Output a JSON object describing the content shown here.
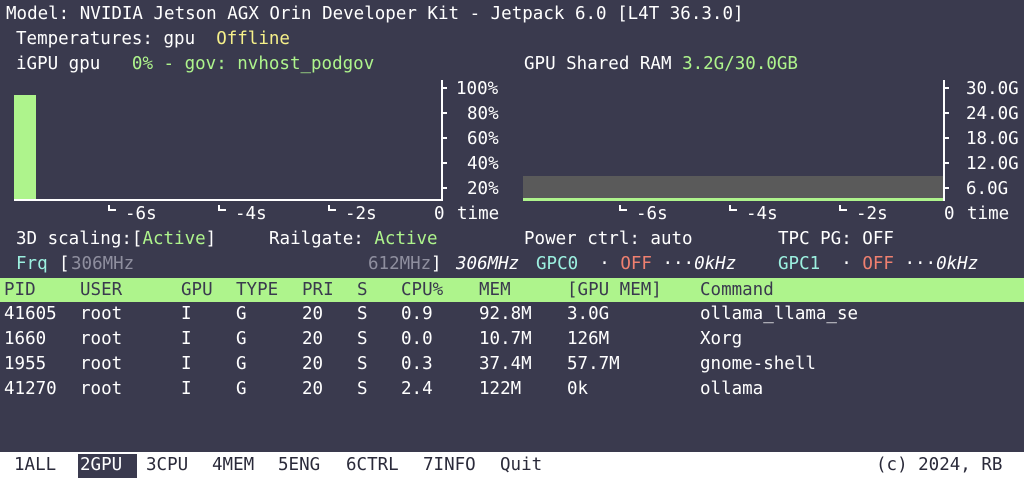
{
  "title": "Model: NVIDIA Jetson AGX Orin Developer Kit - Jetpack 6.0 [L4T 36.3.0]",
  "temperatures": {
    "label": "Temperatures: gpu",
    "value": "Offline"
  },
  "igpu": {
    "label": "iGPU gpu",
    "value": "0% - gov: nvhost_podgov",
    "load_fraction": 0.93
  },
  "gpu_ram": {
    "label": "GPU Shared RAM",
    "value": "3.2G/30.0GB",
    "used_fraction": 0.107
  },
  "left_chart": {
    "y_ticks": [
      "100%",
      "80%",
      "60%",
      "40%",
      "20%"
    ],
    "x_ticks": [
      "-6s",
      "-4s",
      "-2s",
      "0"
    ],
    "x_label": "time"
  },
  "right_chart": {
    "y_ticks": [
      "30.0G",
      "24.0G",
      "18.0G",
      "12.0G",
      "6.0G"
    ],
    "x_ticks": [
      "-6s",
      "-4s",
      "-2s",
      "0"
    ],
    "x_label": "time"
  },
  "scaling": {
    "label": "3D scaling:[",
    "value": "Active",
    "end": "]"
  },
  "railgate": {
    "label": "Railgate:",
    "value": "Active"
  },
  "power": {
    "label": "Power ctrl: auto"
  },
  "tpc": {
    "label": "TPC PG: OFF"
  },
  "freq": {
    "label": "Frq",
    "open": "[",
    "min": "306MHz",
    "max": "612MHz",
    "close": "]",
    "current": "306MHz"
  },
  "gpc0": {
    "name": "GPC0",
    "dot": "·",
    "state": "OFF",
    "dots": "···",
    "freq": "0kHz"
  },
  "gpc1": {
    "name": "GPC1",
    "dot": "·",
    "state": "OFF",
    "dots": "···",
    "freq": "0kHz"
  },
  "table": {
    "headers": [
      "PID",
      "USER",
      "GPU",
      "TYPE",
      "PRI",
      "S",
      "CPU%",
      "MEM",
      "[GPU MEM]",
      "Command"
    ],
    "rows": [
      [
        "41605",
        "root",
        "I",
        "G",
        "20",
        "S",
        "0.9",
        "92.8M",
        "3.0G",
        "ollama_llama_se"
      ],
      [
        "1660",
        "root",
        "I",
        "G",
        "20",
        "S",
        "0.0",
        "10.7M",
        "126M",
        "Xorg"
      ],
      [
        "1955",
        "root",
        "I",
        "G",
        "20",
        "S",
        "0.3",
        "37.4M",
        "57.7M",
        "gnome-shell"
      ],
      [
        "41270",
        "root",
        "I",
        "G",
        "20",
        "S",
        "2.4",
        "122M",
        "0k",
        "ollama"
      ]
    ]
  },
  "footer": {
    "tabs": [
      "1ALL",
      "2GPU",
      "3CPU",
      "4MEM",
      "5ENG",
      "6CTRL",
      "7INFO",
      "Quit"
    ],
    "active_tab": "2GPU",
    "copyright": "(c) 2024, RB"
  },
  "colors": {
    "background": "#3a3a4e",
    "accent_green": "#aef48c",
    "yellow": "#f6f08a",
    "cyan": "#9cf0e0",
    "red": "#f08070",
    "grey_bar": "#5a5a5a"
  }
}
